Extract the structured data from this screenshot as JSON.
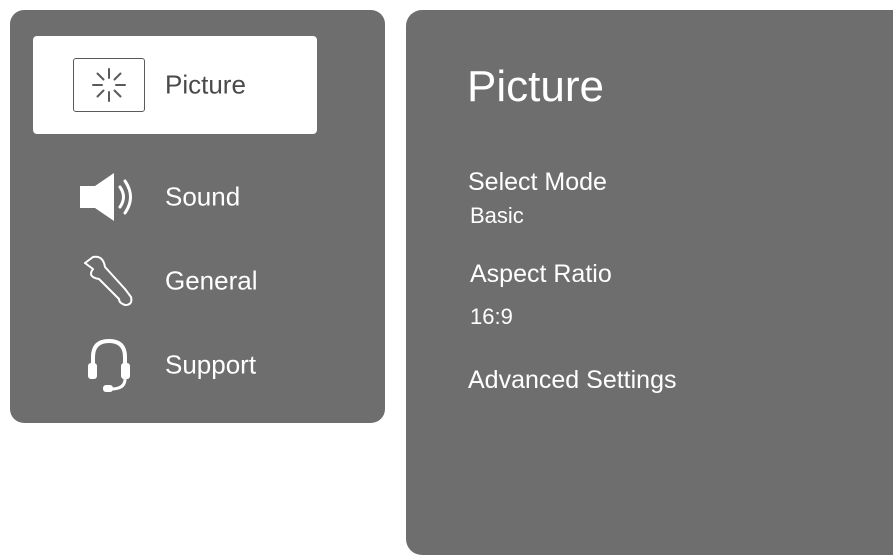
{
  "menu": {
    "items": [
      {
        "label": "Picture",
        "icon": "picture-icon",
        "selected": true
      },
      {
        "label": "Sound",
        "icon": "speaker-icon",
        "selected": false
      },
      {
        "label": "General",
        "icon": "wrench-icon",
        "selected": false
      },
      {
        "label": "Support",
        "icon": "headset-icon",
        "selected": false
      }
    ]
  },
  "detail": {
    "title": "Picture",
    "settings": [
      {
        "label": "Select Mode",
        "value": "Basic"
      },
      {
        "label": "Aspect Ratio",
        "value": "16:9"
      },
      {
        "label": "Advanced Settings"
      }
    ]
  },
  "colors": {
    "panel": "#6e6e6e",
    "selected_bg": "#ffffff",
    "text": "#ffffff",
    "selected_text": "#4a4a4a"
  }
}
